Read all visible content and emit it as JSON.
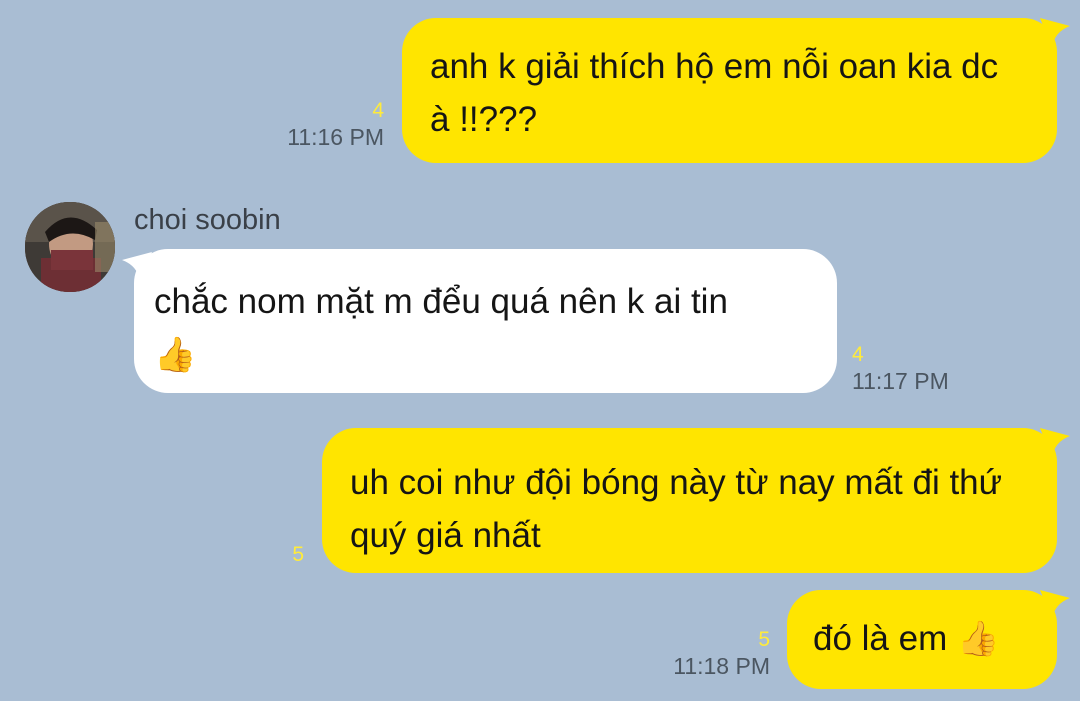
{
  "messages": [
    {
      "direction": "outgoing",
      "text": "anh k giải thích hộ em nỗi oan kia dc à !!???",
      "unread_count": "4",
      "time": "11:16 PM"
    },
    {
      "direction": "incoming",
      "sender": "choi soobin",
      "text": "chắc nom mặt m đểu quá nên k ai tin",
      "emoji": "👍",
      "emoji_icon": "thumbs-up-icon",
      "unread_count": "4",
      "time": "11:17 PM"
    },
    {
      "direction": "outgoing",
      "text": "uh coi như đội bóng này từ nay mất đi thứ quý giá nhất",
      "unread_count": "5",
      "time": ""
    },
    {
      "direction": "outgoing",
      "text": "đó là em",
      "emoji": "👍",
      "emoji_icon": "thumbs-up-icon",
      "unread_count": "5",
      "time": "11:18 PM"
    }
  ],
  "colors": {
    "background": "#a9bdd3",
    "outgoing_bubble": "#ffe500",
    "incoming_bubble": "#ffffff",
    "unread": "#ffeb3b",
    "time": "#4b5661"
  }
}
